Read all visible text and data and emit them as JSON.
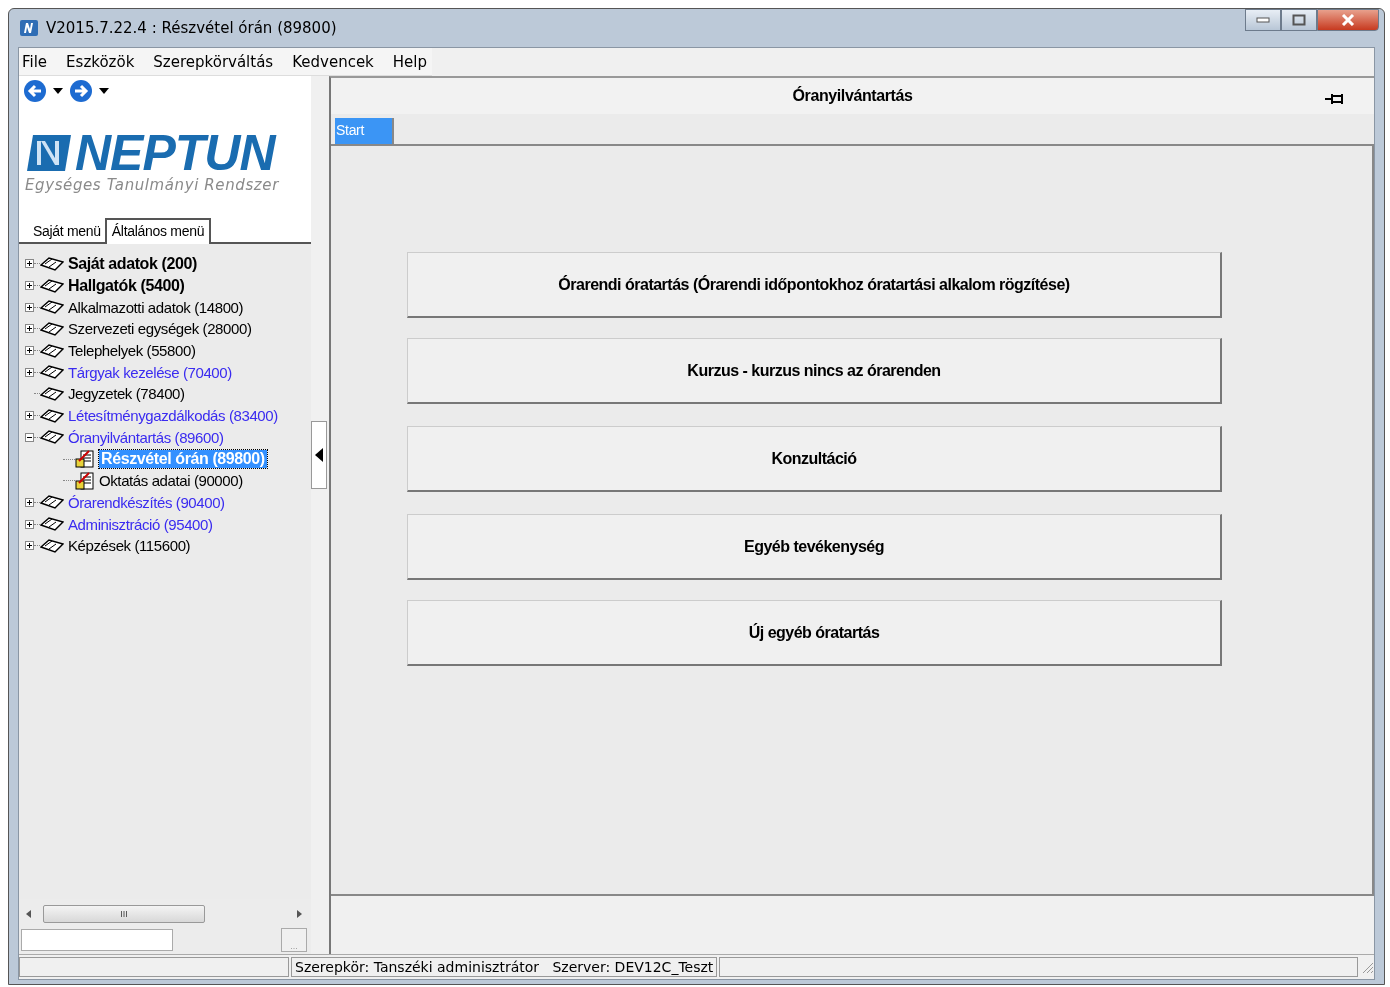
{
  "window": {
    "title": "V2015.7.22.4 : Részvétel órán (89800)"
  },
  "menu": [
    "File",
    "Eszközök",
    "Szerepkörváltás",
    "Kedvencek",
    "Help"
  ],
  "logo": {
    "name": "NEPTUN",
    "tagline": "Egységes Tanulmányi Rendszer"
  },
  "menu_tabs": [
    {
      "label": "Saját menü",
      "selected": false
    },
    {
      "label": "Általános menü",
      "selected": true
    }
  ],
  "tree": [
    {
      "label": "Saját adatok (200)",
      "bold": true,
      "color": "#000000",
      "expanded": false
    },
    {
      "label": "Hallgatók (5400)",
      "bold": true,
      "color": "#000000",
      "expanded": false
    },
    {
      "label": "Alkalmazotti adatok (14800)",
      "bold": false,
      "color": "#000000",
      "expanded": false
    },
    {
      "label": "Szervezeti egységek (28000)",
      "bold": false,
      "color": "#000000",
      "expanded": false
    },
    {
      "label": "Telephelyek (55800)",
      "bold": false,
      "color": "#000000",
      "expanded": false
    },
    {
      "label": "Tárgyak kezelése (70400)",
      "bold": false,
      "color": "#3a2bf0",
      "expanded": false
    },
    {
      "label": "Jegyzetek (78400)",
      "bold": false,
      "color": "#000000"
    },
    {
      "label": "Létesítménygazdálkodás (83400)",
      "bold": false,
      "color": "#3a2bf0",
      "expanded": false
    },
    {
      "label": "Óranyilvántartás (89600)",
      "bold": false,
      "color": "#3a2bf0",
      "expanded": true,
      "children": [
        {
          "label": "Részvétel órán (89800)",
          "selected": true
        },
        {
          "label": "Oktatás adatai (90000)",
          "selected": false
        }
      ]
    },
    {
      "label": "Órarendkészítés (90400)",
      "bold": false,
      "color": "#3a2bf0",
      "expanded": false
    },
    {
      "label": "Adminisztráció (95400)",
      "bold": false,
      "color": "#3a2bf0",
      "expanded": false
    },
    {
      "label": "Képzések (115600)",
      "bold": false,
      "color": "#000000",
      "expanded": false
    }
  ],
  "panel": {
    "title": "Óranyilvántartás",
    "tabs": [
      {
        "label": "Start",
        "selected": true
      }
    ],
    "buttons": [
      "Órarendi óratartás (Órarendi időpontokhoz óratartási alkalom rögzítése)",
      "Kurzus - kurzus nincs az órarenden",
      "Konzultáció",
      "Egyéb tevékenység",
      "Új egyéb óratartás"
    ]
  },
  "scroll_grip": "III",
  "browse_button": "...",
  "status_bar": [
    "Szerepkör: Tanszéki adminisztrátor",
    "Szerver: DEV12C_Teszt"
  ]
}
